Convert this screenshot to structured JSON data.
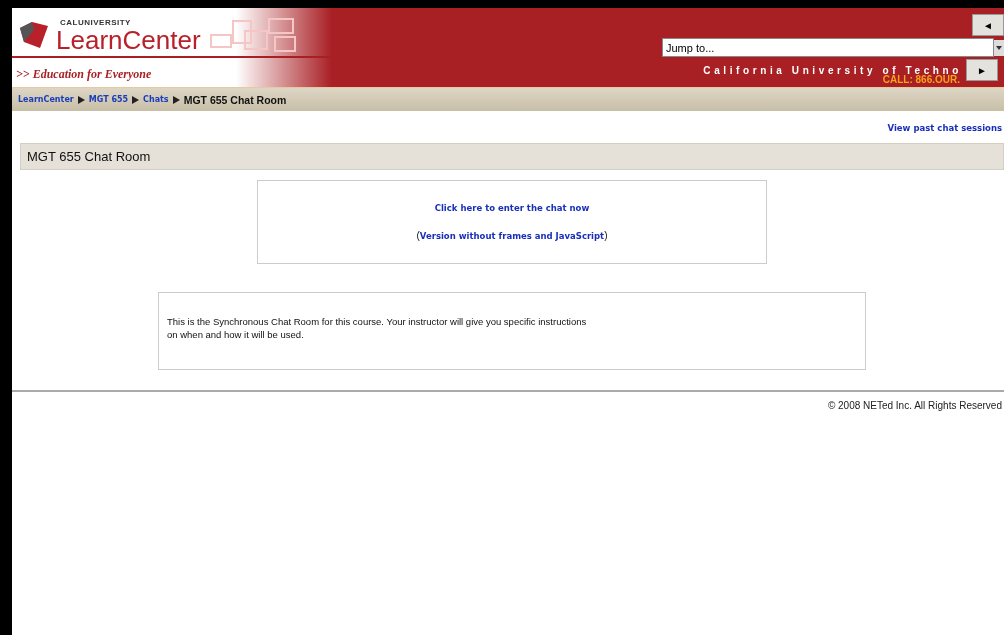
{
  "header": {
    "brand_small": "CALUNIVERSITY",
    "brand": "LearnCenter",
    "tagline": ">> Education for Everyone",
    "jump": {
      "placeholder": "Jump to..."
    },
    "university": "California University of Techno",
    "call": "CALL: 866.OUR.",
    "prev_button": "◄",
    "next_button": "►"
  },
  "breadcrumb": [
    {
      "label": "LearnCenter",
      "link": true
    },
    {
      "label": "MGT 655",
      "link": true
    },
    {
      "label": "Chats",
      "link": true
    },
    {
      "label": "MGT 655 Chat Room",
      "link": false
    }
  ],
  "past_sessions_link": "View past chat sessions",
  "section_title": "MGT 655 Chat Room",
  "enter_link": "Click here to enter the chat now",
  "alt_version": {
    "open": "(",
    "link": "Version without frames and JavaScript",
    "close": ")"
  },
  "description": "This is the Synchronous Chat Room for this course. Your instructor will give you specific instructions on when and how it will be used.",
  "footer": "© 2008 NETed Inc. All Rights Reserved"
}
